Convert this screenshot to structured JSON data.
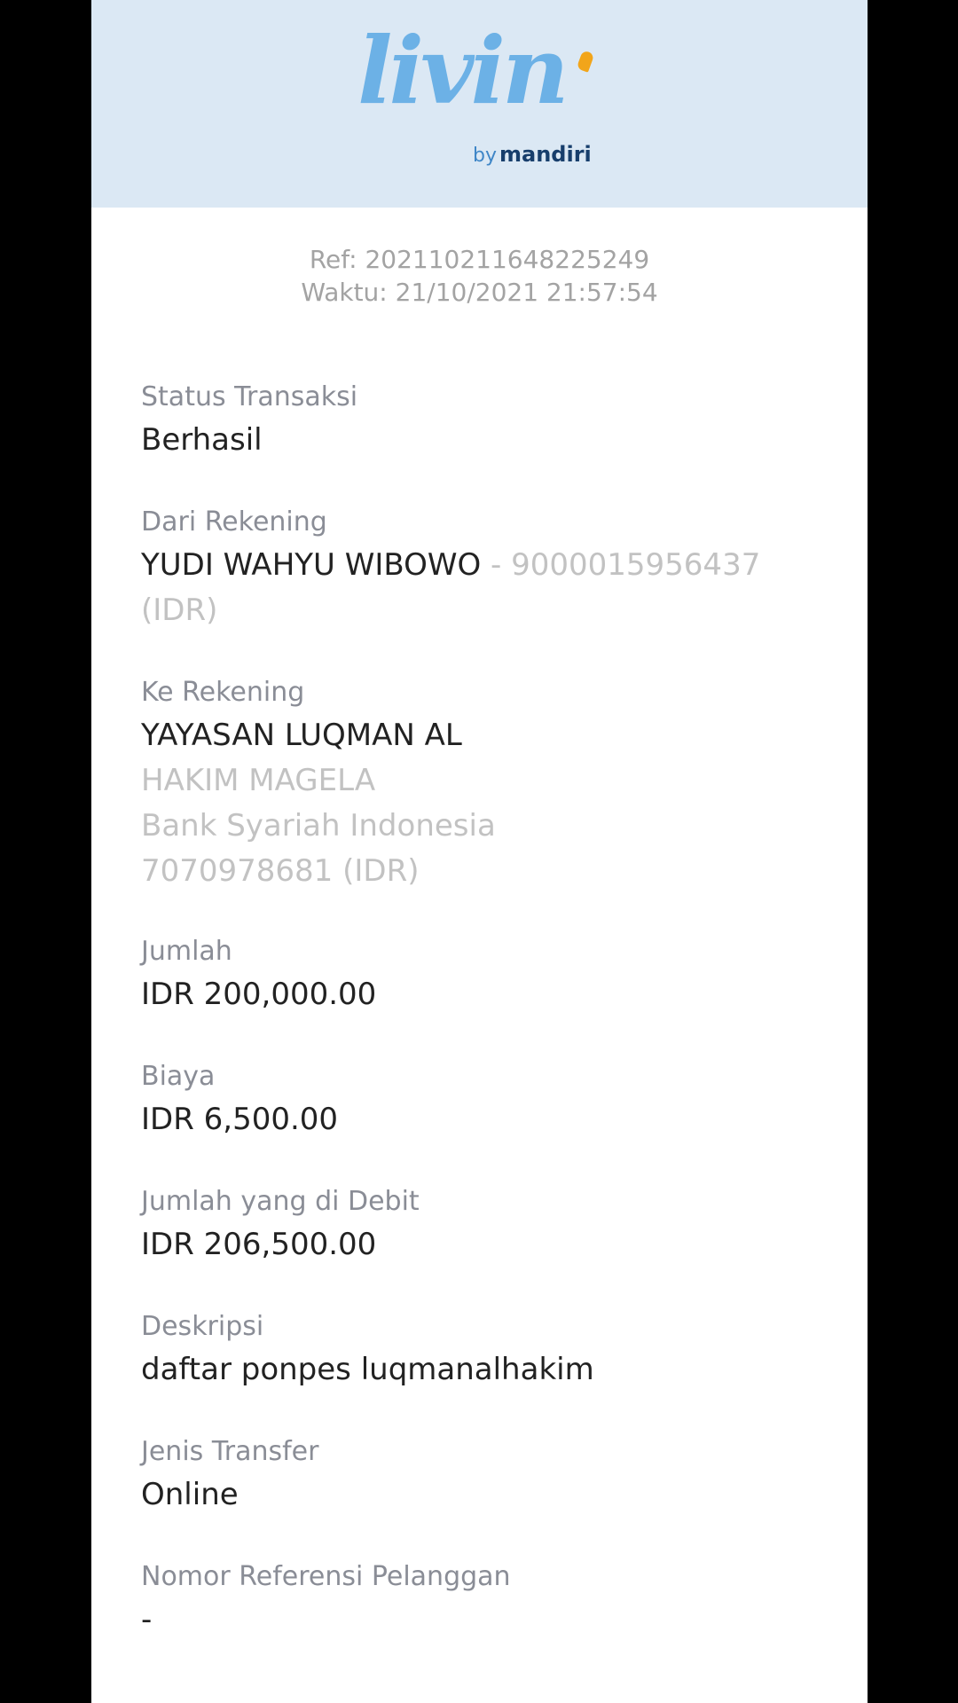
{
  "header": {
    "logo_wordmark": "livin",
    "logo_by": "by",
    "logo_brand": "mandiri"
  },
  "ref": "Ref: 20211021164822524 9",
  "ref_line": "Ref: 202110211648225249",
  "time": "Waktu: 21/10/2021 21:57:54",
  "fields": {
    "status": {
      "label": "Status Transaksi",
      "value": "Berhasil"
    },
    "from": {
      "label": "Dari Rekening",
      "name": "YUDI WAHYU WIBOWO",
      "account": " - 9000015956437",
      "currency": "(IDR)"
    },
    "to": {
      "label": "Ke Rekening",
      "name": "YAYASAN LUQMAN AL",
      "name_cont": "HAKIM MAGELA",
      "bank": "Bank Syariah Indonesia",
      "account": "7070978681 (IDR)"
    },
    "amount": {
      "label": "Jumlah",
      "value": "IDR 200,000.00"
    },
    "fee": {
      "label": "Biaya",
      "value": "IDR 6,500.00"
    },
    "debit": {
      "label": "Jumlah yang di Debit",
      "value": "IDR 206,500.00"
    },
    "description": {
      "label": "Deskripsi",
      "value": "daftar ponpes luqmanalhakim"
    },
    "transfer_type": {
      "label": "Jenis Transfer",
      "value": "Online"
    },
    "customer_ref": {
      "label": "Nomor Referensi Pelanggan",
      "value": "-"
    }
  }
}
